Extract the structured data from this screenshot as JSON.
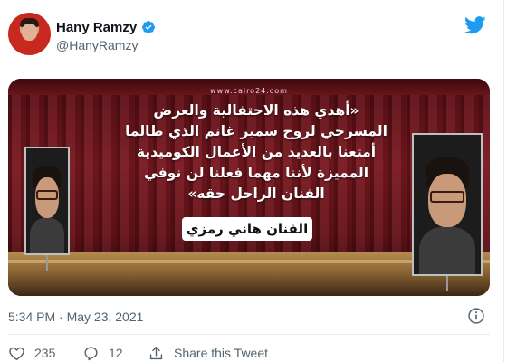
{
  "author": {
    "display_name": "Hany Ramzy",
    "handle": "@HanyRamzy",
    "verified": true
  },
  "media": {
    "watermark": "www.cairo24.com",
    "quote_lines": [
      "«أهدي هذه الاحتفالية والعرض",
      "المسرحي لروح سمير غانم الذي طالما",
      "أمتعنا بالعديد من الأعمال الكوميدية",
      "المميزة لأننا مهما فعلنا لن نوفي",
      "الفنان الراحل حقه»"
    ],
    "caption": "الفنان هاني رمزي"
  },
  "timestamp": "5:34 PM · May 23, 2021",
  "actions": {
    "likes": "235",
    "replies": "12",
    "share_label": "Share this Tweet"
  },
  "colors": {
    "brand": "#1d9bf0",
    "secondary_text": "#536471"
  }
}
